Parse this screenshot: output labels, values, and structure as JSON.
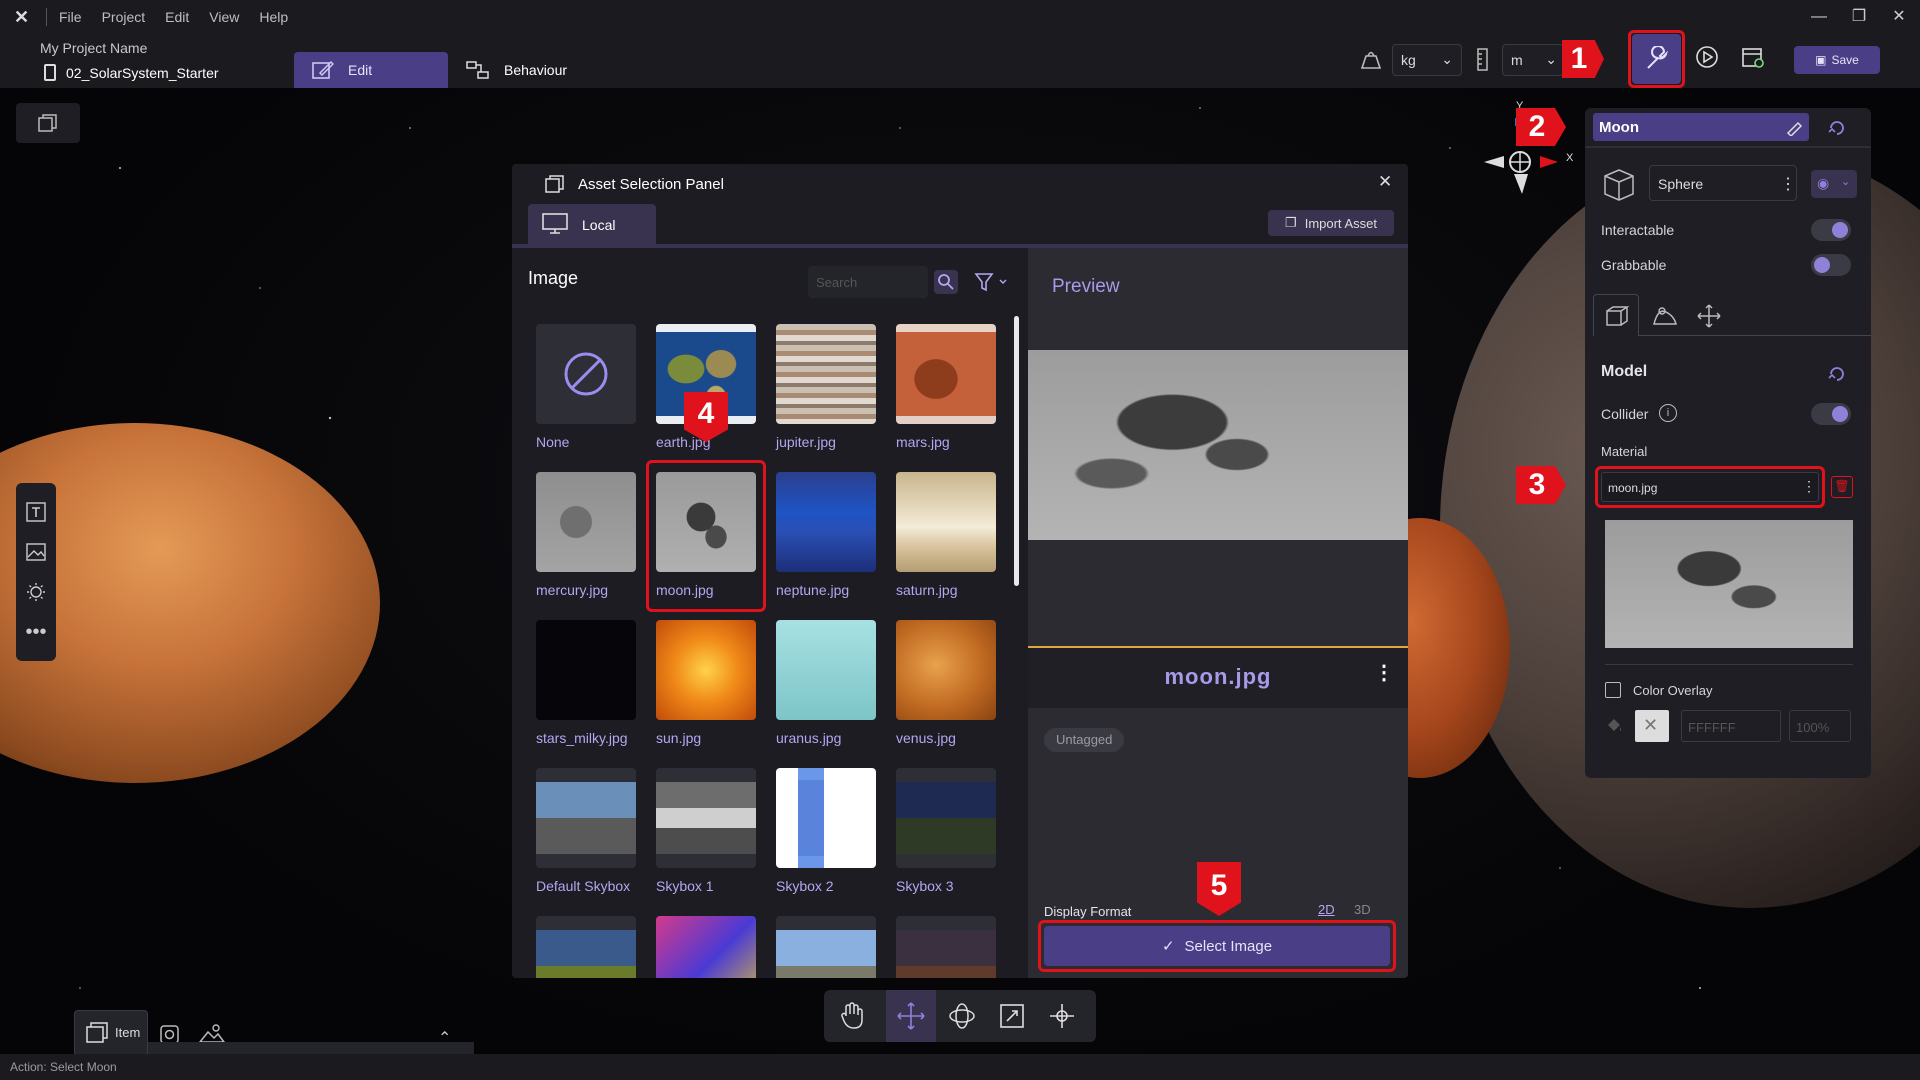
{
  "menu": {
    "file": "File",
    "project": "Project",
    "edit": "Edit",
    "view": "View",
    "help": "Help"
  },
  "project": {
    "name": "My Project Name",
    "scene": "02_SolarSystem_Starter"
  },
  "modes": {
    "edit": "Edit",
    "behaviour": "Behaviour"
  },
  "toolbar": {
    "mass_unit": "kg",
    "length_unit": "m",
    "save_label": "Save"
  },
  "asset_panel": {
    "title": "Asset Selection Panel",
    "tab_local": "Local",
    "import_label": "Import Asset",
    "section": "Image",
    "search_placeholder": "Search",
    "items": [
      {
        "label": "None"
      },
      {
        "label": "earth.jpg"
      },
      {
        "label": "jupiter.jpg"
      },
      {
        "label": "mars.jpg"
      },
      {
        "label": "mercury.jpg"
      },
      {
        "label": "moon.jpg"
      },
      {
        "label": "neptune.jpg"
      },
      {
        "label": "saturn.jpg"
      },
      {
        "label": "stars_milky.jpg"
      },
      {
        "label": "sun.jpg"
      },
      {
        "label": "uranus.jpg"
      },
      {
        "label": "venus.jpg"
      },
      {
        "label": "Default Skybox"
      },
      {
        "label": "Skybox 1"
      },
      {
        "label": "Skybox 2"
      },
      {
        "label": "Skybox 3"
      }
    ],
    "preview_title": "Preview",
    "preview_name": "moon.jpg",
    "tag": "Untagged",
    "display_format_label": "Display Format",
    "format_2d": "2D",
    "format_3d": "3D",
    "select_label": "Select Image"
  },
  "inspector": {
    "object_name": "Moon",
    "shape": "Sphere",
    "interactable": "Interactable",
    "grabbable": "Grabbable",
    "model_section": "Model",
    "collider": "Collider",
    "material_label": "Material",
    "material_value": "moon.jpg",
    "color_overlay": "Color Overlay",
    "color_hex": "FFFFFF",
    "opacity": "100%"
  },
  "annotations": {
    "a1": "1",
    "a2": "2",
    "a3": "3",
    "a4": "4",
    "a5": "5"
  },
  "bottom": {
    "item_tab": "Item",
    "status": "Action: Select Moon"
  },
  "gizmo": {
    "y": "Y",
    "x": "X"
  },
  "colors": {
    "accent": "#8f80d8",
    "annotation": "#e0121b",
    "label": "#b5a6f2",
    "preview_title": "#a79ae8"
  }
}
